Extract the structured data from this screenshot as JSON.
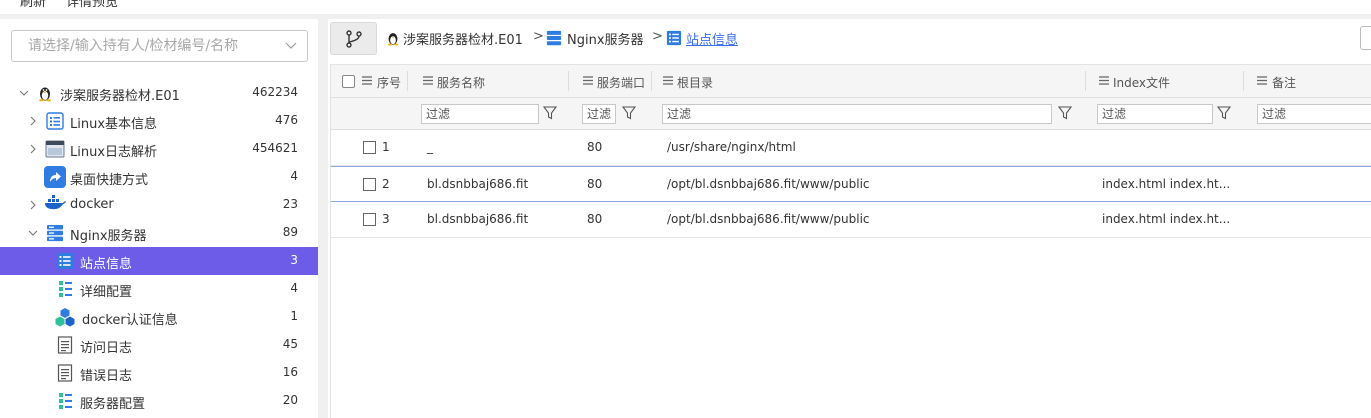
{
  "top_menu": [
    "刷新",
    "详情预览"
  ],
  "search": {
    "placeholder": "请选择/输入持有人/检材编号/名称"
  },
  "tree": [
    {
      "label": "涉案服务器检材.E01",
      "count": "462234",
      "icon": "linux-penguin-icon",
      "level": 0,
      "expanded": true
    },
    {
      "label": "Linux基本信息",
      "count": "476",
      "icon": "list-icon",
      "level": 1,
      "expandable": true
    },
    {
      "label": "Linux日志解析",
      "count": "454621",
      "icon": "log-window-icon",
      "level": 1,
      "expandable": true
    },
    {
      "label": "桌面快捷方式",
      "count": "4",
      "icon": "shortcut-icon",
      "level": 1
    },
    {
      "label": "docker",
      "count": "23",
      "icon": "docker-icon",
      "level": 1,
      "expandable": true
    },
    {
      "label": "Nginx服务器",
      "count": "89",
      "icon": "server-icon",
      "level": 1,
      "expanded": true
    },
    {
      "label": "站点信息",
      "count": "3",
      "icon": "site-info-icon",
      "level": 2,
      "selected": true
    },
    {
      "label": "详细配置",
      "count": "4",
      "icon": "config-list-icon",
      "level": 2
    },
    {
      "label": "docker认证信息",
      "count": "1",
      "icon": "cubes-icon",
      "level": 2
    },
    {
      "label": "访问日志",
      "count": "45",
      "icon": "document-icon",
      "level": 2
    },
    {
      "label": "错误日志",
      "count": "16",
      "icon": "document-icon",
      "level": 2
    },
    {
      "label": "服务器配置",
      "count": "20",
      "icon": "config-list-icon",
      "level": 2
    }
  ],
  "breadcrumb": {
    "items": [
      "涉案服务器检材.E01",
      "Nginx服务器",
      "站点信息"
    ],
    "separator": ">"
  },
  "table": {
    "columns": [
      "序号",
      "服务名称",
      "服务端口",
      "根目录",
      "Index文件",
      "备注"
    ],
    "filter_placeholder": "过滤",
    "rows": [
      {
        "no": "1",
        "name": "_",
        "port": "80",
        "root": "/usr/share/nginx/html",
        "index": "",
        "note": ""
      },
      {
        "no": "2",
        "name": "bl.dsnbbaj686.fit",
        "port": "80",
        "root": "/opt/bl.dsnbbaj686.fit/www/public",
        "index": "index.html index.ht...",
        "note": ""
      },
      {
        "no": "3",
        "name": "bl.dsnbbaj686.fit",
        "port": "80",
        "root": "/opt/bl.dsnbbaj686.fit/www/public",
        "index": "index.html index.ht...",
        "note": ""
      }
    ]
  },
  "colors": {
    "selected_bg": "#6c5ce7",
    "link": "#3a6df0",
    "icon_blue": "#2f7de1"
  }
}
